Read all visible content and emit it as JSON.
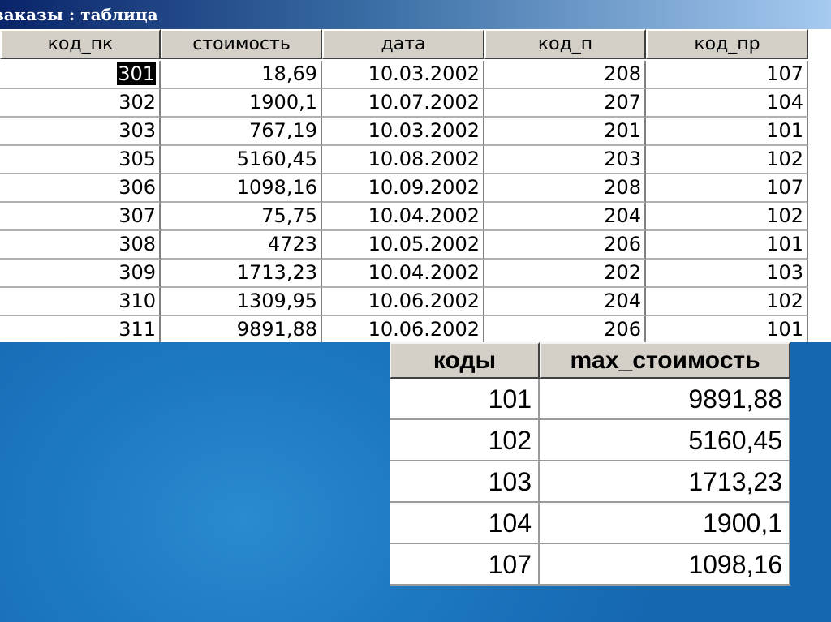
{
  "window": {
    "title": "заказы : таблица"
  },
  "orders_table": {
    "columns": [
      "код_пк",
      "стоимость",
      "дата",
      "код_п",
      "код_пр"
    ],
    "rows": [
      [
        "301",
        "18,69",
        "10.03.2002",
        "208",
        "107"
      ],
      [
        "302",
        "1900,1",
        "10.07.2002",
        "207",
        "104"
      ],
      [
        "303",
        "767,19",
        "10.03.2002",
        "201",
        "101"
      ],
      [
        "305",
        "5160,45",
        "10.08.2002",
        "203",
        "102"
      ],
      [
        "306",
        "1098,16",
        "10.09.2002",
        "208",
        "107"
      ],
      [
        "307",
        "75,75",
        "10.04.2002",
        "204",
        "102"
      ],
      [
        "308",
        "4723",
        "10.05.2002",
        "206",
        "101"
      ],
      [
        "309",
        "1713,23",
        "10.04.2002",
        "202",
        "103"
      ],
      [
        "310",
        "1309,95",
        "10.06.2002",
        "204",
        "102"
      ],
      [
        "311",
        "9891,88",
        "10.06.2002",
        "206",
        "101"
      ]
    ],
    "selected_cell": "301"
  },
  "result_table": {
    "columns": [
      "коды",
      "max_стоимость"
    ],
    "rows": [
      [
        "101",
        "9891,88"
      ],
      [
        "102",
        "5160,45"
      ],
      [
        "103",
        "1713,23"
      ],
      [
        "104",
        "1900,1"
      ],
      [
        "107",
        "1098,16"
      ]
    ]
  },
  "colors": {
    "desktop": "#1a72bd",
    "titlebar_start": "#0a246a",
    "titlebar_end": "#a6caf0",
    "header_face": "#d4d0c8",
    "selection": "#000000"
  }
}
